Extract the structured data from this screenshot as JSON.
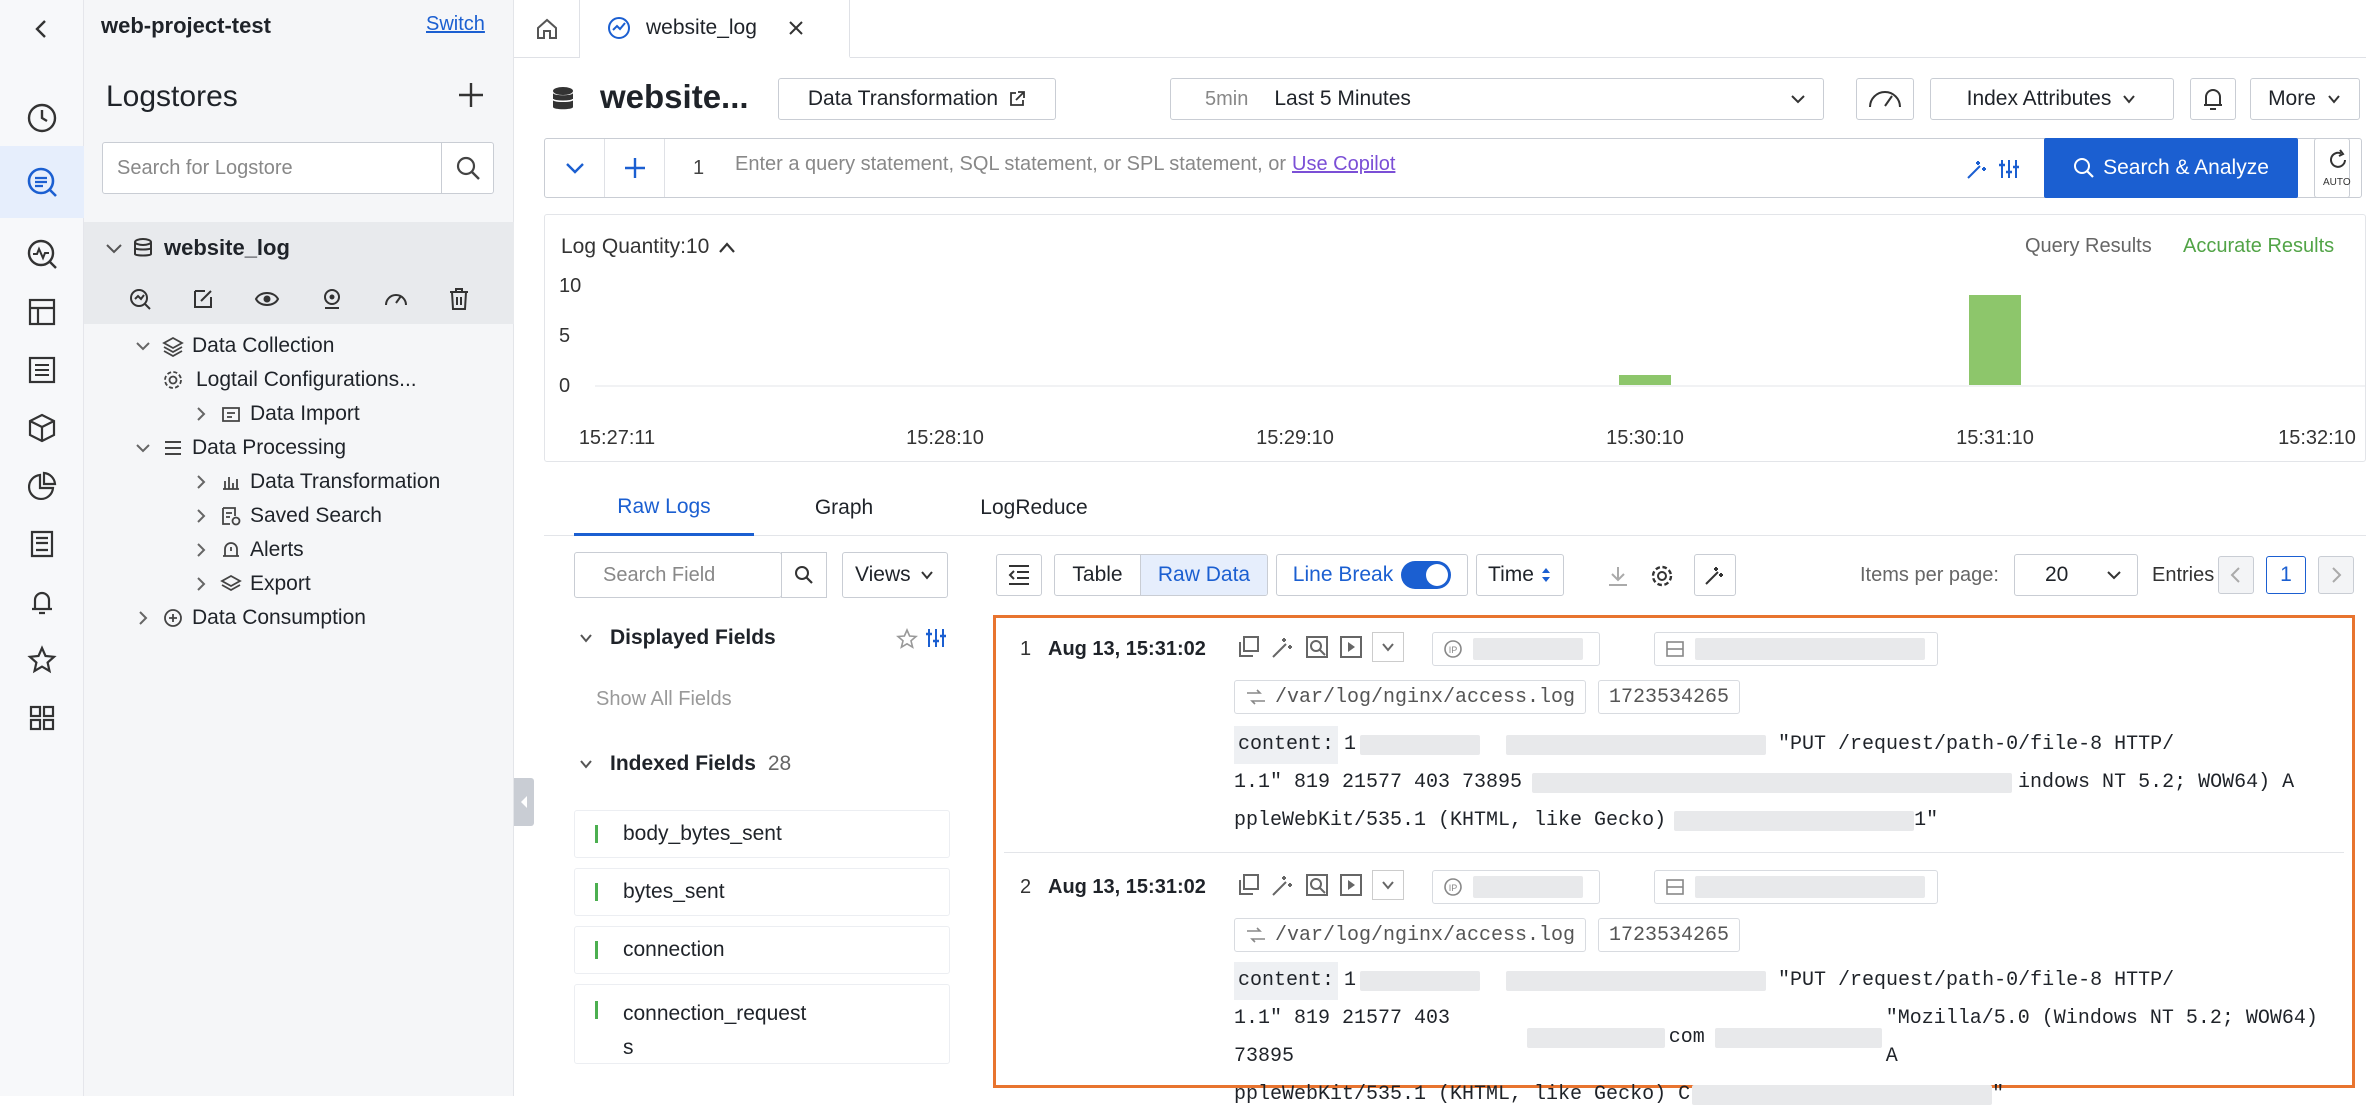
{
  "project": {
    "name": "web-project-test",
    "switch_label": "Switch"
  },
  "tabs": [
    {
      "label": "website_log"
    }
  ],
  "sidebar": {
    "title": "Logstores",
    "search_placeholder": "Search for Logstore",
    "logstore_name": "website_log",
    "items": [
      {
        "label": "Data Collection"
      },
      {
        "label": "Logtail Configurations..."
      },
      {
        "label": "Data Import"
      },
      {
        "label": "Data Processing"
      },
      {
        "label": "Data Transformation"
      },
      {
        "label": "Saved Search"
      },
      {
        "label": "Alerts"
      },
      {
        "label": "Export"
      },
      {
        "label": "Data Consumption"
      }
    ]
  },
  "header": {
    "title": "website...",
    "data_transformation_label": "Data Transformation",
    "time_short": "5min",
    "time_label": "Last 5 Minutes",
    "index_attributes_label": "Index Attributes",
    "more_label": "More"
  },
  "query": {
    "line_number": "1",
    "placeholder_text": "Enter a query statement, SQL statement, or SPL statement, or",
    "copilot_link": "Use Copilot",
    "search_button": "Search & Analyze",
    "auto_label": "AUTO"
  },
  "histogram": {
    "log_quantity_label": "Log Quantity:10",
    "query_results_label": "Query Results",
    "accurate_results_label": "Accurate Results"
  },
  "chart_data": {
    "type": "bar",
    "y_ticks": [
      "10",
      "5",
      "0"
    ],
    "x_ticks": [
      "15:27:11",
      "15:28:10",
      "15:29:10",
      "15:30:10",
      "15:31:10",
      "15:32:10"
    ],
    "ylim": [
      0,
      10
    ],
    "points": [
      {
        "x": "15:30:10",
        "y": 1
      },
      {
        "x": "15:31:10",
        "y": 9
      }
    ],
    "bar_color": "#8dc66b"
  },
  "result_tabs": [
    {
      "label": "Raw Logs"
    },
    {
      "label": "Graph"
    },
    {
      "label": "LogReduce"
    }
  ],
  "fields_panel": {
    "search_placeholder": "Search Field",
    "views_label": "Views",
    "displayed_fields_label": "Displayed Fields",
    "show_all_fields": "Show All Fields",
    "indexed_fields_label": "Indexed Fields",
    "indexed_fields_count": "28",
    "fields": [
      {
        "name": "body_bytes_sent"
      },
      {
        "name": "bytes_sent"
      },
      {
        "name": "connection"
      },
      {
        "name": "connection_request",
        "name_wrap": "s"
      }
    ]
  },
  "toolbar": {
    "table_label": "Table",
    "raw_data_label": "Raw Data",
    "line_break_label": "Line Break",
    "time_label": "Time",
    "items_per_page_label": "Items per page:",
    "items_per_page_value": "20",
    "entries_label": "Entries",
    "page_number": "1"
  },
  "logs": [
    {
      "index": "1",
      "time": "Aug 13, 15:31:02",
      "source": "/var/log/nginx/access.log",
      "timestamp": "1723534265",
      "content_key": "content:",
      "line1_start": "1",
      "line1_end": "\"PUT /request/path-0/file-8 HTTP/",
      "line2_start": "1.1\" 819 21577 403 73895",
      "line2_end": "indows NT 5.2; WOW64) A",
      "line3_start": "ppleWebKit/535.1 (KHTML, like Gecko)",
      "line3_end": "1\""
    },
    {
      "index": "2",
      "time": "Aug 13, 15:31:02",
      "source": "/var/log/nginx/access.log",
      "timestamp": "1723534265",
      "content_key": "content:",
      "line1_start": "1",
      "line1_end": "\"PUT /request/path-0/file-8 HTTP/",
      "line2_start": "1.1\" 819 21577 403 73895",
      "line2_mid": "com",
      "line2_end": "\"Mozilla/5.0 (Windows NT 5.2; WOW64) A",
      "line3_start": "ppleWebKit/535.1 (KHTML, like Gecko) C",
      "line3_end": "\""
    }
  ]
}
